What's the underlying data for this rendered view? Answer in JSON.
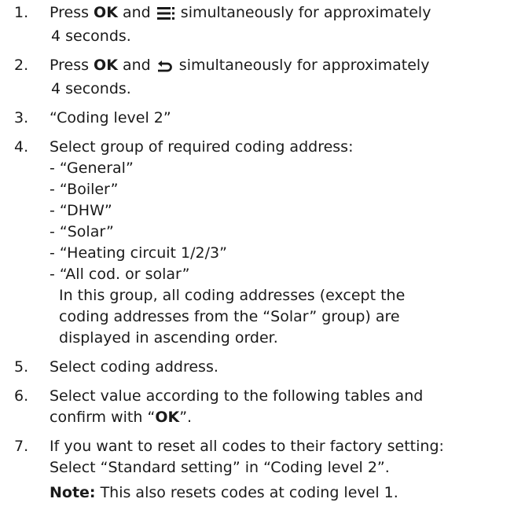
{
  "steps": [
    {
      "num": "1.",
      "pre": "Press ",
      "key": "OK",
      "mid": " and ",
      "icon": "menu-icon",
      "post": " simultaneously for approximately",
      "cont": "4 seconds."
    },
    {
      "num": "2.",
      "pre": "Press ",
      "key": "OK",
      "mid": " and ",
      "icon": "back-arrow-icon",
      "post": " simultaneously for approximately",
      "cont": "4 seconds."
    },
    {
      "num": "3.",
      "text": "“Coding level 2”"
    },
    {
      "num": "4.",
      "text": "Select group of required coding address:",
      "groups": [
        "- “General”",
        "- “Boiler”",
        "- “DHW”",
        "- “Solar”",
        "- “Heating circuit 1/2/3”",
        "- “All cod. or solar”"
      ],
      "group_note": [
        "In this group, all coding addresses (except the",
        "coding addresses from the “Solar” group) are",
        "displayed in ascending order."
      ]
    },
    {
      "num": "5.",
      "text": "Select coding address."
    },
    {
      "num": "6.",
      "line1": "Select value according to the following tables and",
      "line2_pre": "confirm with “",
      "line2_key": "OK",
      "line2_post": "”."
    },
    {
      "num": "7.",
      "line1": "If you want to reset all codes to their factory setting:",
      "line2": "Select “Standard setting” in “Coding level 2”.",
      "note_label": "Note:",
      "note_text": " This also resets codes at coding level 1."
    }
  ]
}
